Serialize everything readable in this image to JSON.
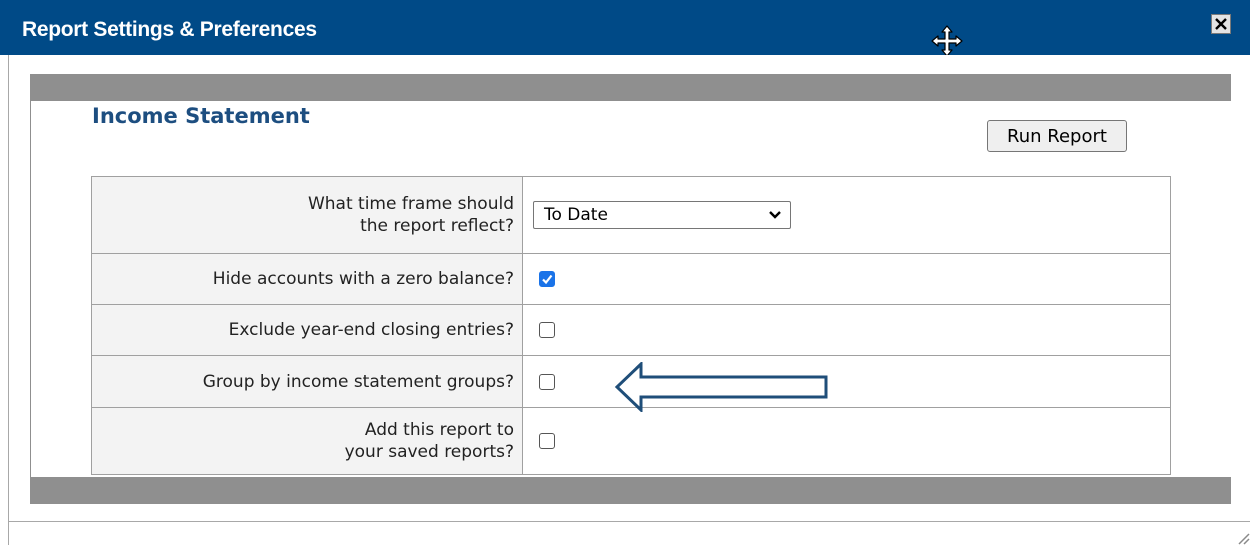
{
  "window": {
    "title": "Report Settings & Preferences",
    "icons": {
      "move": "move-cursor-icon",
      "close": "close-icon",
      "resize": "resize-grip-icon"
    }
  },
  "report": {
    "heading": "Income Statement",
    "run_button": "Run Report"
  },
  "options": [
    {
      "label_line1": "What time frame should",
      "label_line2": "the report reflect?",
      "type": "select",
      "value": "To Date"
    },
    {
      "label_line1": "Hide accounts with a zero balance?",
      "label_line2": "",
      "type": "checkbox",
      "checked": true
    },
    {
      "label_line1": "Exclude year-end closing entries?",
      "label_line2": "",
      "type": "checkbox",
      "checked": false
    },
    {
      "label_line1": "Group by income statement groups?",
      "label_line2": "",
      "type": "checkbox",
      "checked": false
    },
    {
      "label_line1": "Add this report to",
      "label_line2": "your saved reports?",
      "type": "checkbox",
      "checked": false
    }
  ],
  "annotation": {
    "icon": "left-arrow-icon",
    "color": "#1f4e79"
  },
  "colors": {
    "titlebar": "#004a87",
    "heading": "#1d4e80",
    "panel_band": "#8f8f8f",
    "checkbox_on": "#1a73e8"
  }
}
